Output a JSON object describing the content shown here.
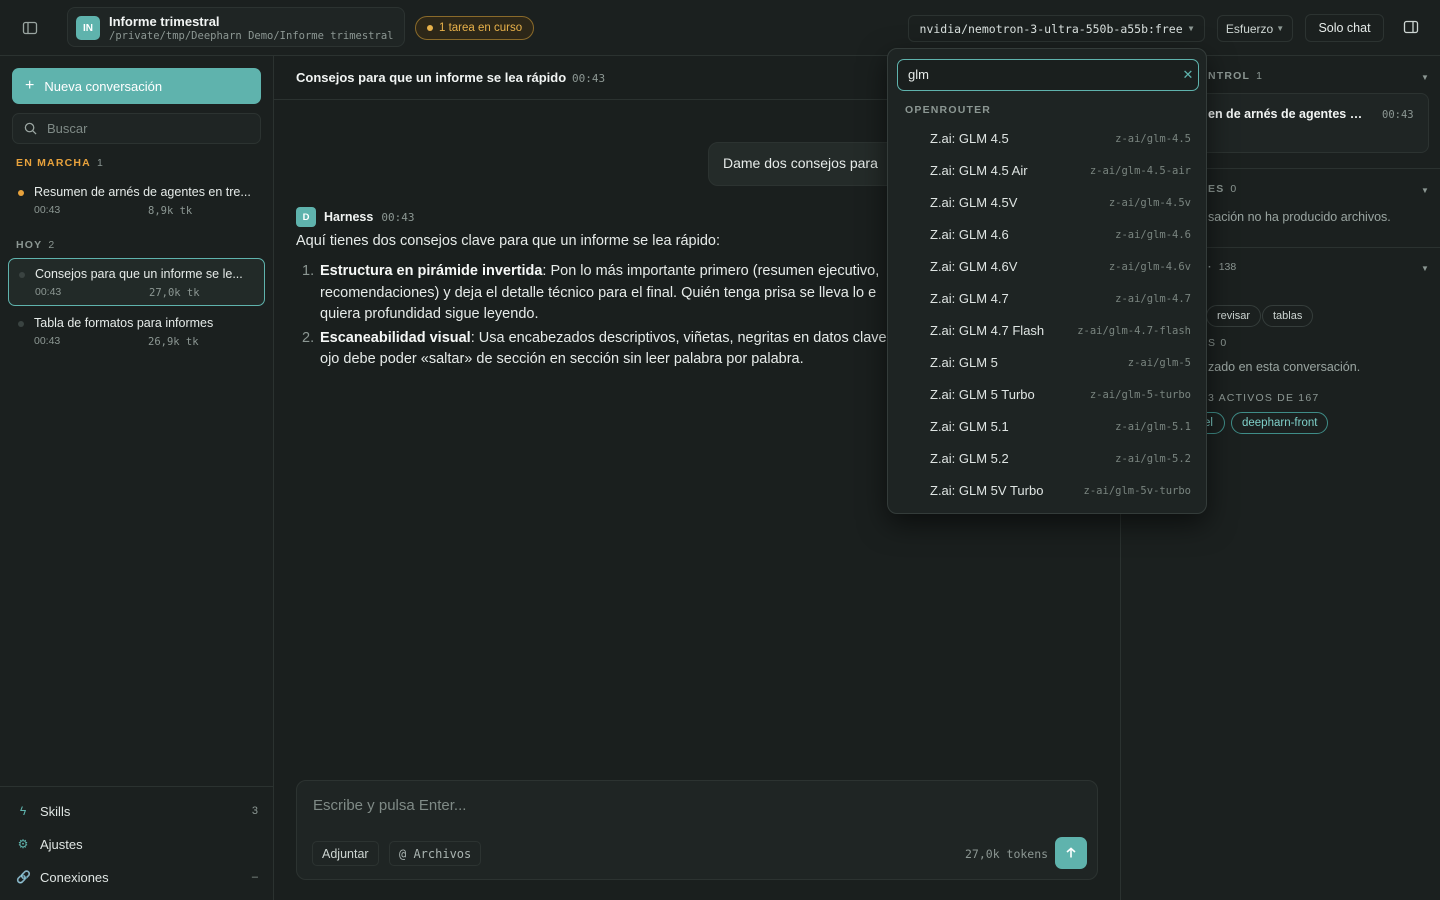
{
  "topbar": {
    "project_initials": "IN",
    "project_name": "Informe trimestral",
    "project_path": "/private/tmp/Deepharn Demo/Informe trimestral",
    "task_badge": "1 tarea en curso",
    "model": "nvidia/nemotron-3-ultra-550b-a55b:free",
    "effort": "Esfuerzo",
    "solo_chat": "Solo chat"
  },
  "sidebar": {
    "new_conversation": "Nueva conversación",
    "search_placeholder": "Buscar",
    "running_label": "EN MARCHA",
    "running_count": "1",
    "today_label": "HOY",
    "today_count": "2",
    "running": [
      {
        "title": "Resumen de arnés de agentes en tre...",
        "time": "00:43",
        "tokens": "8,9k tk"
      }
    ],
    "today": [
      {
        "title": "Consejos para que un informe se le...",
        "time": "00:43",
        "tokens": "27,0k tk"
      },
      {
        "title": "Tabla de formatos para informes",
        "time": "00:43",
        "tokens": "26,9k tk"
      }
    ],
    "footer": {
      "skills": "Skills",
      "skills_count": "3",
      "settings": "Ajustes",
      "connections": "Conexiones",
      "connections_value": "–"
    }
  },
  "main": {
    "title": "Consejos para que un informe se lea rápido",
    "time": "00:43",
    "user_message": "Dame dos consejos para",
    "assistant": {
      "avatar": "D",
      "name": "Harness",
      "time": "00:43",
      "intro": "Aquí tienes dos consejos clave para que un informe se lea rápido:",
      "tips": [
        {
          "num": "1.",
          "bold": "Estructura en pirámide invertida",
          "line1": ": Pon lo más importante primero (resumen ejecutivo,",
          "line2": "recomendaciones) y deja el detalle técnico para el final. Quién tenga prisa se lleva lo e",
          "line3": "quiera profundidad sigue leyendo."
        },
        {
          "num": "2.",
          "bold": "Escaneabilidad visual",
          "line1": ": Usa encabezados descriptivos, viñetas, negritas en datos clave",
          "line2": "ojo debe poder «saltar» de sección en sección sin leer palabra por palabra."
        }
      ]
    },
    "composer": {
      "placeholder": "Escribe y pulsa Enter...",
      "attach": "Adjuntar",
      "files": "@ Archivos",
      "tokens": "27,0k tokens"
    }
  },
  "right_panel": {
    "control_title": "NTROL",
    "control_count": "1",
    "control_card_title": "en de arnés de agentes en t...",
    "control_card_time": "00:43",
    "files_title": "ES",
    "files_count": "0",
    "files_text": "sación no ha producido archivos.",
    "skills_title": "·",
    "skills_count": "138",
    "skill_tags": [
      "revisar",
      "tablas"
    ],
    "memory_label": "S",
    "memory_count": "0",
    "memory_text": "zado en esta conversación.",
    "active_label": "3 ACTIVOS DE 167",
    "active_tags": [
      "el",
      "deepharn-front"
    ]
  },
  "dropdown": {
    "query": "glm",
    "group": "OPENROUTER",
    "models": [
      {
        "name": "Z.ai: GLM 4.5",
        "id": "z-ai/glm-4.5"
      },
      {
        "name": "Z.ai: GLM 4.5 Air",
        "id": "z-ai/glm-4.5-air"
      },
      {
        "name": "Z.ai: GLM 4.5V",
        "id": "z-ai/glm-4.5v"
      },
      {
        "name": "Z.ai: GLM 4.6",
        "id": "z-ai/glm-4.6"
      },
      {
        "name": "Z.ai: GLM 4.6V",
        "id": "z-ai/glm-4.6v"
      },
      {
        "name": "Z.ai: GLM 4.7",
        "id": "z-ai/glm-4.7"
      },
      {
        "name": "Z.ai: GLM 4.7 Flash",
        "id": "z-ai/glm-4.7-flash"
      },
      {
        "name": "Z.ai: GLM 5",
        "id": "z-ai/glm-5"
      },
      {
        "name": "Z.ai: GLM 5 Turbo",
        "id": "z-ai/glm-5-turbo"
      },
      {
        "name": "Z.ai: GLM 5.1",
        "id": "z-ai/glm-5.1"
      },
      {
        "name": "Z.ai: GLM 5.2",
        "id": "z-ai/glm-5.2"
      },
      {
        "name": "Z.ai: GLM 5V Turbo",
        "id": "z-ai/glm-5v-turbo"
      }
    ]
  },
  "colors": {
    "accent": "#5fb3ad",
    "running": "#e8a23c",
    "background": "#1a1f1e"
  }
}
